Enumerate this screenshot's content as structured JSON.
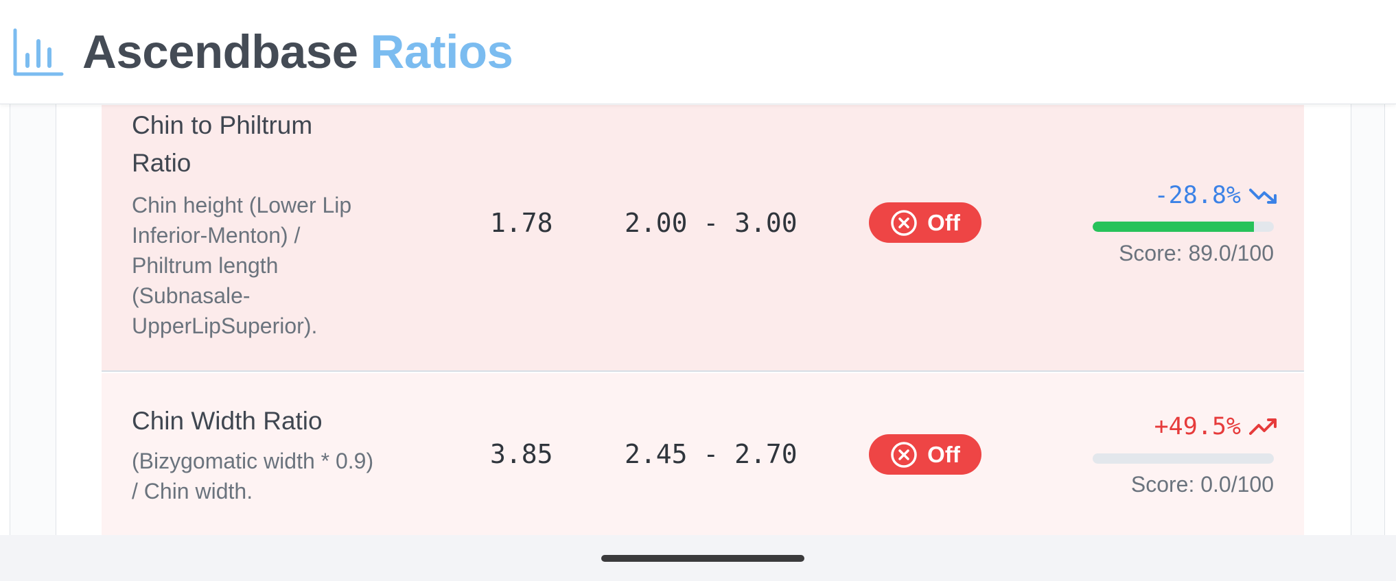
{
  "header": {
    "brand_main": "Ascendbase",
    "brand_accent": "Ratios",
    "logo_icon": "bar-chart-icon",
    "accent_color": "#7bbcf0"
  },
  "ratios": [
    {
      "name": "Chin to Philtrum Ratio",
      "description": "Chin height (Lower Lip Inferior-Menton) / Philtrum length (Subnasale-UpperLipSuperior).",
      "value": "1.78",
      "ideal_range": "2.00 - 3.00",
      "status": "Off",
      "status_icon": "x-circle-icon",
      "deviation": "-28.8%",
      "trend_icon": "trend-down-icon",
      "score_fraction": 0.89,
      "score_text": "Score: 89.0/100",
      "row_color": "#fcebeb"
    },
    {
      "name": "Chin Width Ratio",
      "description": "(Bizygomatic width * 0.9) / Chin width.",
      "value": "3.85",
      "ideal_range": "2.45 - 2.70",
      "status": "Off",
      "status_icon": "x-circle-icon",
      "deviation": "+49.5%",
      "trend_icon": "trend-up-icon",
      "score_fraction": 0.0,
      "score_text": "Score: 0.0/100",
      "row_color": "#fef3f3"
    }
  ],
  "colors": {
    "status_off": "#ee4545",
    "deviation_negative": "#3b82e6",
    "deviation_positive": "#e63b3b",
    "score_bar": "#27c25a"
  }
}
